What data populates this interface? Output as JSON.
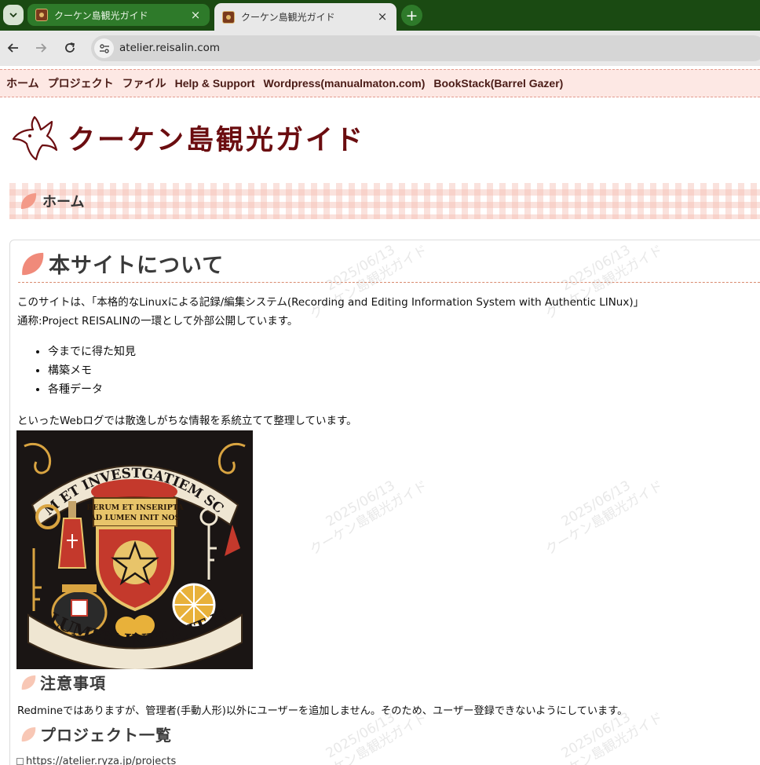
{
  "browser": {
    "tabs": [
      {
        "title": "クーケン島観光ガイド",
        "active": false
      },
      {
        "title": "クーケン島観光ガイド",
        "active": true
      }
    ],
    "close_glyph": "×",
    "newtab_glyph": "+",
    "url": "atelier.reisalin.com",
    "colors": {
      "tabstrip": "#1a4a12",
      "toolbar": "#e8e8e8"
    }
  },
  "nav": {
    "items": [
      "ホーム",
      "プロジェクト",
      "ファイル",
      "Help & Support",
      "Wordpress(manualmaton.com)",
      "BookStack(Barrel Gazer)"
    ]
  },
  "site": {
    "title": "クーケン島観光ガイド",
    "title_color": "#6b0d10"
  },
  "breadcrumb": {
    "current": "ホーム"
  },
  "main": {
    "heading": "本サイトについて",
    "intro_line1": "このサイトは、「本格的なLinuxによる記録/編集システム(Recording and Editing Information System with Authentic LINux)」",
    "intro_line2": "通称:Project REISALINの一環として外部公開しています。",
    "bullets": [
      "今までに得た知見",
      "構築メモ",
      "各種データ"
    ],
    "outro": "といったWebログでは散逸しがちな情報を系統立てて整理しています。",
    "emblem": {
      "top_banner": "RERUM ET INVESTGATIEM SCRIPTA",
      "shield_line1": "RERUM ET INSERIPTA",
      "shield_line2": "AD LUMEN INIT NOS",
      "bottom_banner": "AD LUMEN INDUCIT NOS"
    },
    "notice_heading": "注意事項",
    "notice_text": "Redmineではありますが、管理者(手動人形)以外にユーザーを追加しません。そのため、ユーザー登録できないようにしています。",
    "projects_heading": "プロジェクト一覧",
    "projects_link": "https://atelier.ryza.jp/projects"
  },
  "watermark": {
    "date": "2025/06/13",
    "label": "クーケン島観光ガイド"
  }
}
